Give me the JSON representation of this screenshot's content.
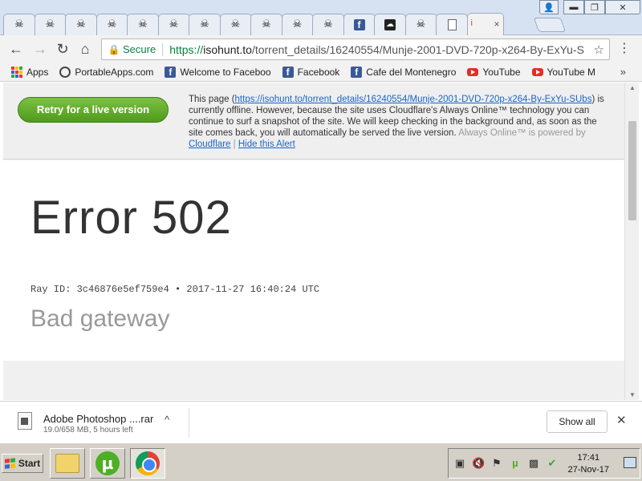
{
  "window": {
    "tabs": [
      {
        "icon": "skull-icon",
        "label": ""
      },
      {
        "icon": "skull-icon",
        "label": ""
      },
      {
        "icon": "skull-icon",
        "label": ""
      },
      {
        "icon": "skull-icon",
        "label": ""
      },
      {
        "icon": "skull-icon",
        "label": ""
      },
      {
        "icon": "skull-icon",
        "label": ""
      },
      {
        "icon": "skull-icon",
        "label": ""
      },
      {
        "icon": "skull-icon",
        "label": ""
      },
      {
        "icon": "skull-icon",
        "label": ""
      },
      {
        "icon": "skull-icon",
        "label": ""
      },
      {
        "icon": "skull-icon",
        "label": ""
      },
      {
        "icon": "facebook-icon",
        "label": ""
      },
      {
        "icon": "cloud-icon",
        "label": ""
      },
      {
        "icon": "skull-icon",
        "label": ""
      },
      {
        "icon": "document-icon",
        "label": ""
      },
      {
        "icon": "active",
        "label": "i"
      }
    ],
    "tab_close": "×"
  },
  "toolbar": {
    "back": "←",
    "forward": "→",
    "reload": "↻",
    "home": "⌂",
    "secure_label": "Secure",
    "url_scheme": "https://",
    "url_host": "isohunt.to",
    "url_path": "/torrent_details/16240554/Munje-2001-DVD-720p-x264-By-ExYu-S",
    "star": "☆",
    "menu": "⋮"
  },
  "bookmarks": {
    "items": [
      {
        "label": "Apps",
        "icon": "apps-grid-icon"
      },
      {
        "label": "PortableApps.com",
        "icon": "portableapps-icon"
      },
      {
        "label": "Welcome to Faceboo",
        "icon": "facebook-icon"
      },
      {
        "label": "Facebook",
        "icon": "facebook-icon"
      },
      {
        "label": "Cafe del Montenegro",
        "icon": "facebook-icon"
      },
      {
        "label": "YouTube",
        "icon": "youtube-icon"
      },
      {
        "label": "YouTube M",
        "icon": "youtube-icon"
      }
    ],
    "more": "»"
  },
  "alert": {
    "retry_label": "Retry for a live version",
    "text_before": "This page (",
    "link_url": "https://isohunt.to/torrent_details/16240554/Munje-2001-DVD-720p-x264-By-ExYu-SUbs",
    "text_after": ") is currently offline. However, because the site uses Cloudflare's Always Online™ technology you can continue to surf a snapshot of the site. We will keep checking in the background and, as soon as the site comes back, you will automatically be served the live version.",
    "powered_by": "Always Online™ is powered by",
    "cloudflare_link": "Cloudflare",
    "pipe": "|",
    "hide_link": "Hide this Alert"
  },
  "error": {
    "title": "Error 502",
    "ray": "Ray ID: 3c46876e5ef759e4 • 2017-11-27 16:40:24 UTC",
    "subtitle": "Bad gateway"
  },
  "download": {
    "filename": "Adobe Photoshop ....rar",
    "status": "19.0/658 MB, 5 hours left",
    "chevron": "^",
    "show_all": "Show all",
    "close": "✕"
  },
  "taskbar": {
    "start_label": "Start",
    "clock_time": "17:41",
    "clock_date": "27-Nov-17"
  },
  "colors": {
    "secure_green": "#0b8043",
    "link_blue": "#1a66c9",
    "retry_green": "#5ba826"
  }
}
